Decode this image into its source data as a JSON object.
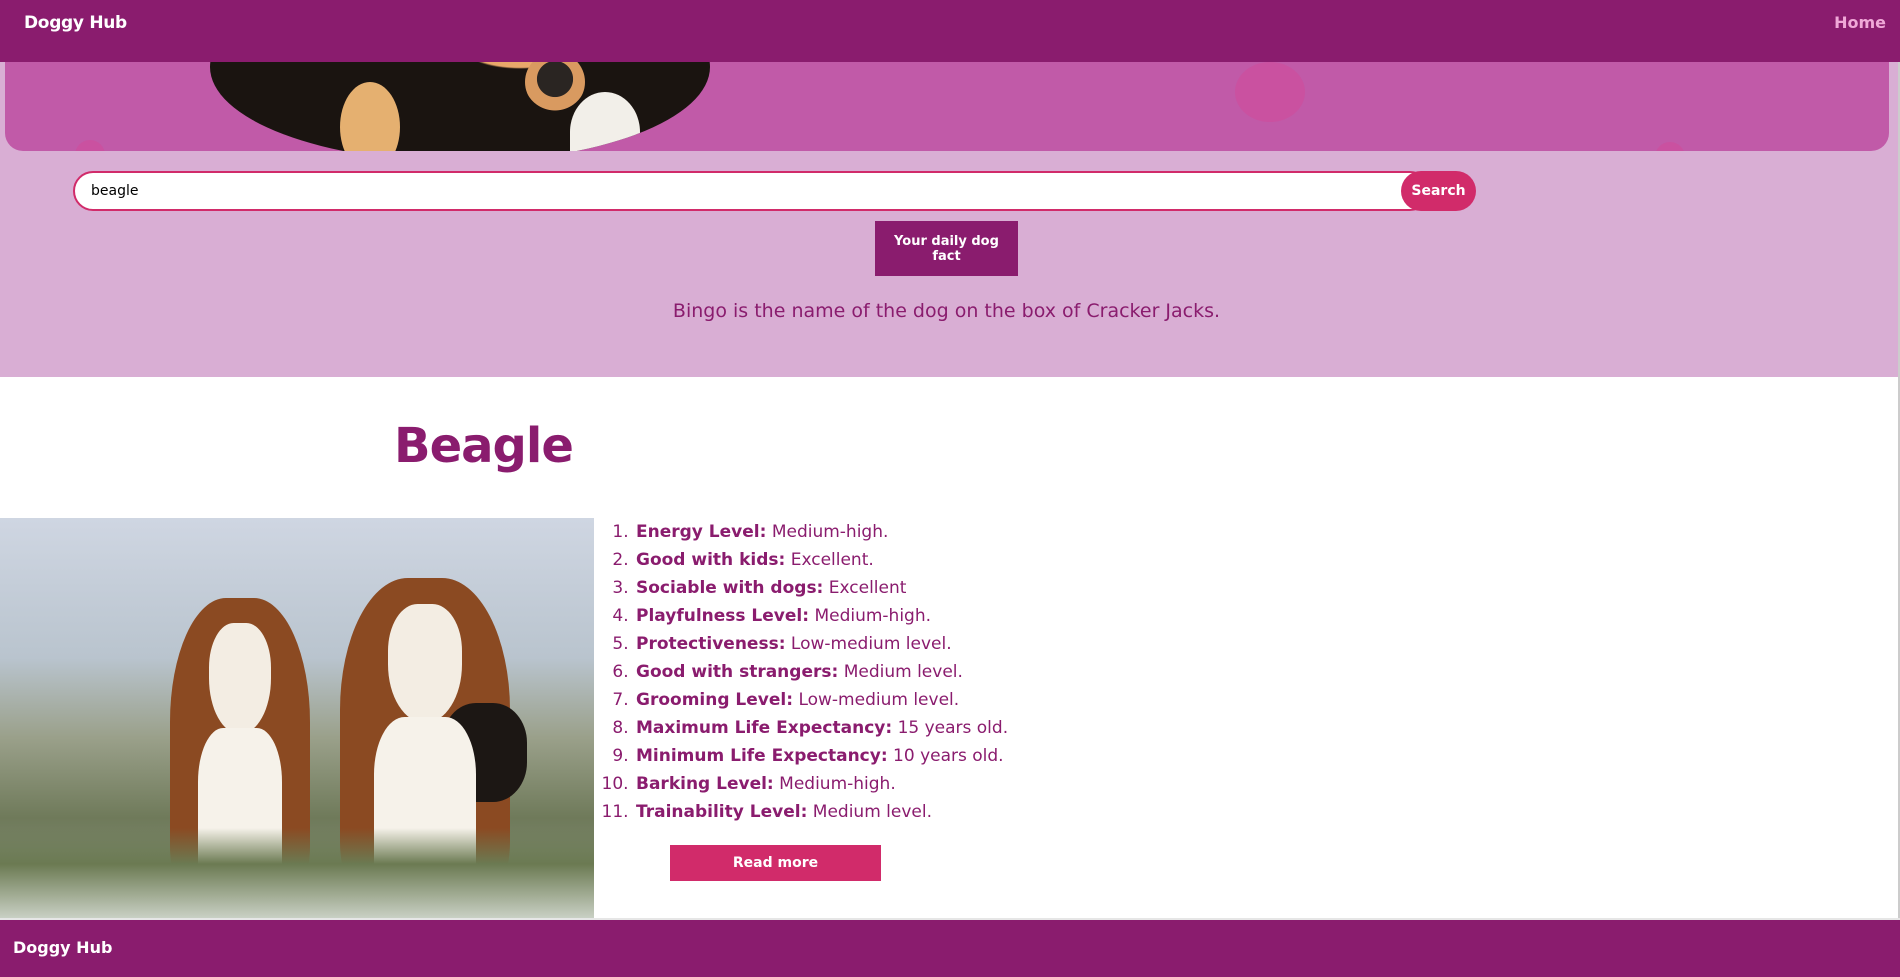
{
  "navbar": {
    "brand": "Doggy Hub",
    "home_link": "Home"
  },
  "search": {
    "value": "beagle",
    "button_label": "Search"
  },
  "daily_fact": {
    "button_label": "Your daily dog fact",
    "text": "Bingo is the name of the dog on the box of Cracker Jacks."
  },
  "breed": {
    "name": "Beagle",
    "traits": [
      {
        "label": "Energy Level:",
        "value": "Medium-high."
      },
      {
        "label": "Good with kids:",
        "value": "Excellent."
      },
      {
        "label": "Sociable with dogs:",
        "value": "Excellent"
      },
      {
        "label": "Playfulness Level:",
        "value": "Medium-high."
      },
      {
        "label": "Protectiveness:",
        "value": "Low-medium level."
      },
      {
        "label": "Good with strangers:",
        "value": "Medium level."
      },
      {
        "label": "Grooming Level:",
        "value": "Low-medium level."
      },
      {
        "label": "Maximum Life Expectancy:",
        "value": "15 years old."
      },
      {
        "label": "Minimum Life Expectancy:",
        "value": "10 years old."
      },
      {
        "label": "Barking Level:",
        "value": "Medium-high."
      },
      {
        "label": "Trainability Level:",
        "value": "Medium level."
      }
    ],
    "read_more_label": "Read more"
  },
  "footer": {
    "brand": "Doggy Hub"
  },
  "colors": {
    "primary": "#8a1c6e",
    "accent": "#d12b6a",
    "hero_bg": "#d9aed4",
    "banner": "#c15aa8"
  }
}
